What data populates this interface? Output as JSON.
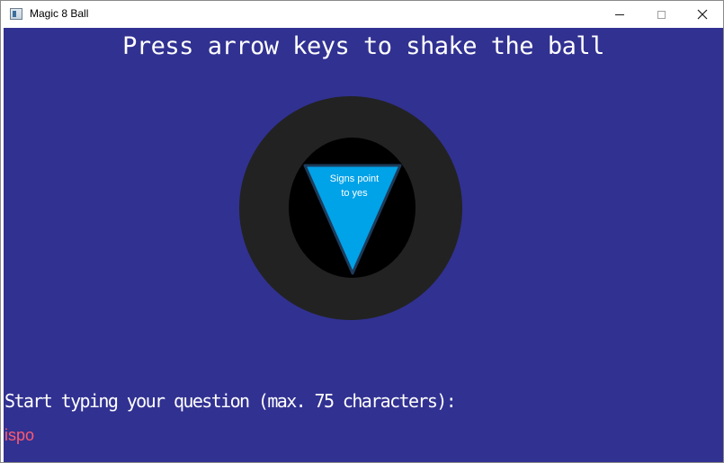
{
  "window": {
    "title": "Magic 8 Ball",
    "icon": "app-window-icon",
    "controls": {
      "minimize": "minimize-icon",
      "maximize": "maximize-icon",
      "close": "close-icon"
    }
  },
  "game": {
    "heading": "Press arrow keys to shake the ball",
    "answer_line1": "Signs point",
    "answer_line2": "to yes",
    "prompt": "Start typing your question (max. 75 characters):",
    "typed_text": "ispo"
  },
  "colors": {
    "background": "#313192",
    "ball": "#222222",
    "ball_window": "#000000",
    "triangle": "#00a2e8",
    "typed_text": "#ff5a6e",
    "text": "#ffffff"
  }
}
